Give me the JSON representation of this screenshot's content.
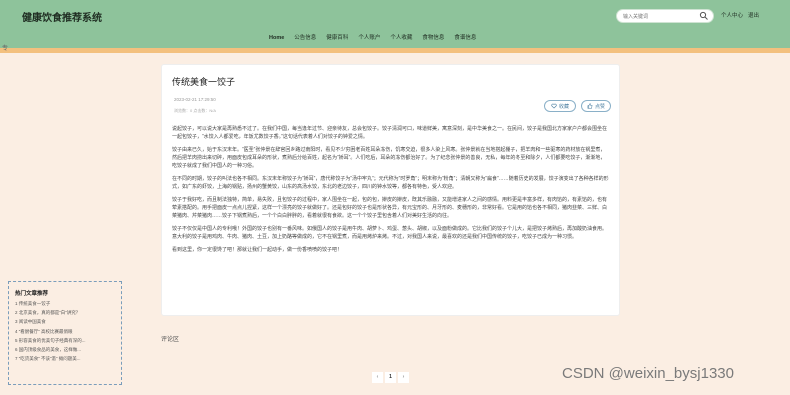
{
  "header": {
    "site_title": "健康饮食推荐系统",
    "search_placeholder": "输入关键词",
    "personal_center": "个人中心",
    "logout": "退出"
  },
  "nav": [
    {
      "label": "Home",
      "active": true
    },
    {
      "label": "公告信息"
    },
    {
      "label": "健康百科"
    },
    {
      "label": "个人账户"
    },
    {
      "label": "个人收藏"
    },
    {
      "label": "食物信息"
    },
    {
      "label": "食谱信息"
    }
  ],
  "left_mark": "专",
  "article": {
    "title": "传统美食一饺子",
    "date": "2023-02-21 17:29:50",
    "stats": "浏览数：0    点击数：N/A",
    "fav_label": "收藏",
    "like_label": "点赞",
    "paragraphs": [
      "说起饺子，可以说大家是再熟悉不过了。在我们中国，每当逢年过节、迎亲待友，总会包饺子。饺子清润可口，味道鲜美，寓意深刻，是中华美食之一。在民间，饺子是我国北方家家户户都会围坐在一起包饺子，“水饺入人都爱吃，年饭尤数饺子香。”这句话代表着人们对饺子的钟爱之情。",
      "饺子由来已久，始于东汉末年。“医圣”张仲景在辞官回乡路过南阳时，看见不少穷困老百姓耳朵冻伤，饥寒交迫，很多人染上风寒。张仲景就在当地搭起棚子，把羊肉和一些驱寒的药材放在锅里煮，然后把羊肉捞出来切碎，用面皮包成耳朵的形状，煮熟后分给百姓，起名为“娇耳”。人们吃后，耳朵的冻伤都治好了。为了纪念张仲景的善良，无私，每年的冬至和除夕，人们都要吃饺子，渐渐地，吃饺子就成了我们中国人的一种习俗。",
      "在不同的时期，饺子的叫法也各不相同。东汉末年称饺子为“娇耳”，唐代称饺子为“汤中牢丸”；元代称为“时罗角”；明末称为“粉角”；清朝又称为“扁食”……随着历史的发展，饺子演变出了各种各样的形式，如广东的虾饺，上海的锅贴，扬州的蟹黄饺，山东的高汤水饺，东北的老边饺子，四川的钟水饺等，都各有特色，受人欢迎。",
      "饺子于我好吃，而且制法独特，简单，易失败，且包饺子的过程中，家人围坐在一起，包的包，擀皮的擀皮，既其乐融融，又能增进家人之间的感情。用料更是丰富多样，有肉馅的，有素馅的，也有荤素搭配的。用手把面皮一点点儿捏紧，这样一个漂亮的饺子就做好了。还是包好的饺子也是形状各异，有元宝形的、月牙形的、麦穗形的，非常好看。它是用的馅也各不相同，猪肉韭菜、三鲜、白菜猪肉、芹菜猪肉……饺子下锅煮熟后，一个个白白胖胖的，看着就很有食欲。这一个个饺子里包含着人们对美好生活的向往。",
      "饺子不仅仅是中国人的专利哦！外国的饺子也别有一番风味。如俄国人的饺子是用牛肉、胡萝卜、鸡蛋、葱头、胡椒，以及面粉做成的。它比我们的饺子个儿大，是把饺子烤熟后，再加酸奶油食用。意大利的饺子是用鸡肉、牛肉、猪肉、土豆，加上奶酪等做成的，它不在锅里煮，而是用烤炉来烤。不过，对我国人来说，最喜欢的还是我们中国传统的饺子，吃饺子已成为一种习惯。",
      "看到这里，你一定很馋了吧！那就让我们一起动手，做一份香喷喷的饺子吧！"
    ]
  },
  "hot_articles": {
    "title": "热门文章推荐",
    "items": [
      "1  传统美食一饺子",
      "2  北京美食，真的都是“白”讲究？",
      "3  阅读中国美食",
      "4  “看厨餐厅” 高校比赛最俏眼",
      "5  形容美食的优美句子经典有深的...",
      "6  国内顶级食品的美食，这样做...",
      "7  “吃货美食” 不该“滥” 摊问题美..."
    ]
  },
  "comment_label": "评论区",
  "pager": {
    "prev": "‹",
    "current": "1",
    "next": "›"
  },
  "watermark": "CSDN @weixin_bysj1330"
}
